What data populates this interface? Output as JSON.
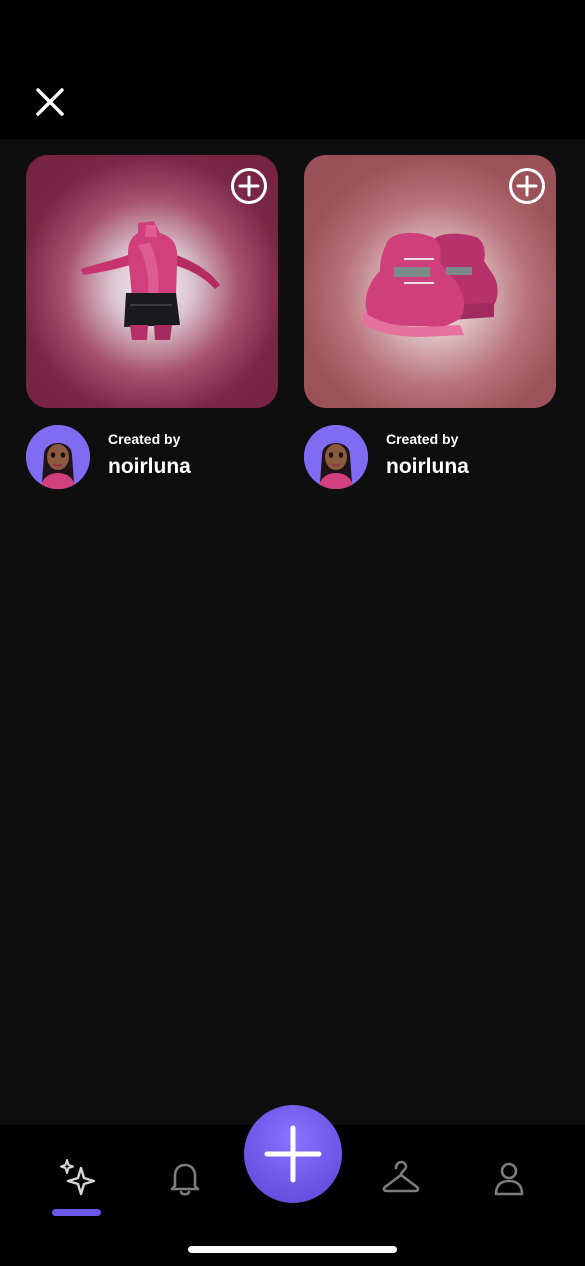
{
  "header": {
    "close_icon": "close-icon"
  },
  "items": [
    {
      "type": "outfit-top-with-skirt",
      "add_icon": "plus-circle-icon",
      "created_by_label": "Created by",
      "creator": "noirluna",
      "bg_color": "#7a2646"
    },
    {
      "type": "boots",
      "add_icon": "plus-circle-icon",
      "created_by_label": "Created by",
      "creator": "noirluna",
      "bg_color": "#9c5259"
    }
  ],
  "nav": {
    "items": [
      {
        "icon": "sparkles-icon",
        "active": true
      },
      {
        "icon": "bell-icon",
        "active": false
      },
      {
        "icon": "plus-icon",
        "active": false
      },
      {
        "icon": "hanger-icon",
        "active": false
      },
      {
        "icon": "user-icon",
        "active": false
      }
    ],
    "accent_color": "#6b57e8"
  }
}
